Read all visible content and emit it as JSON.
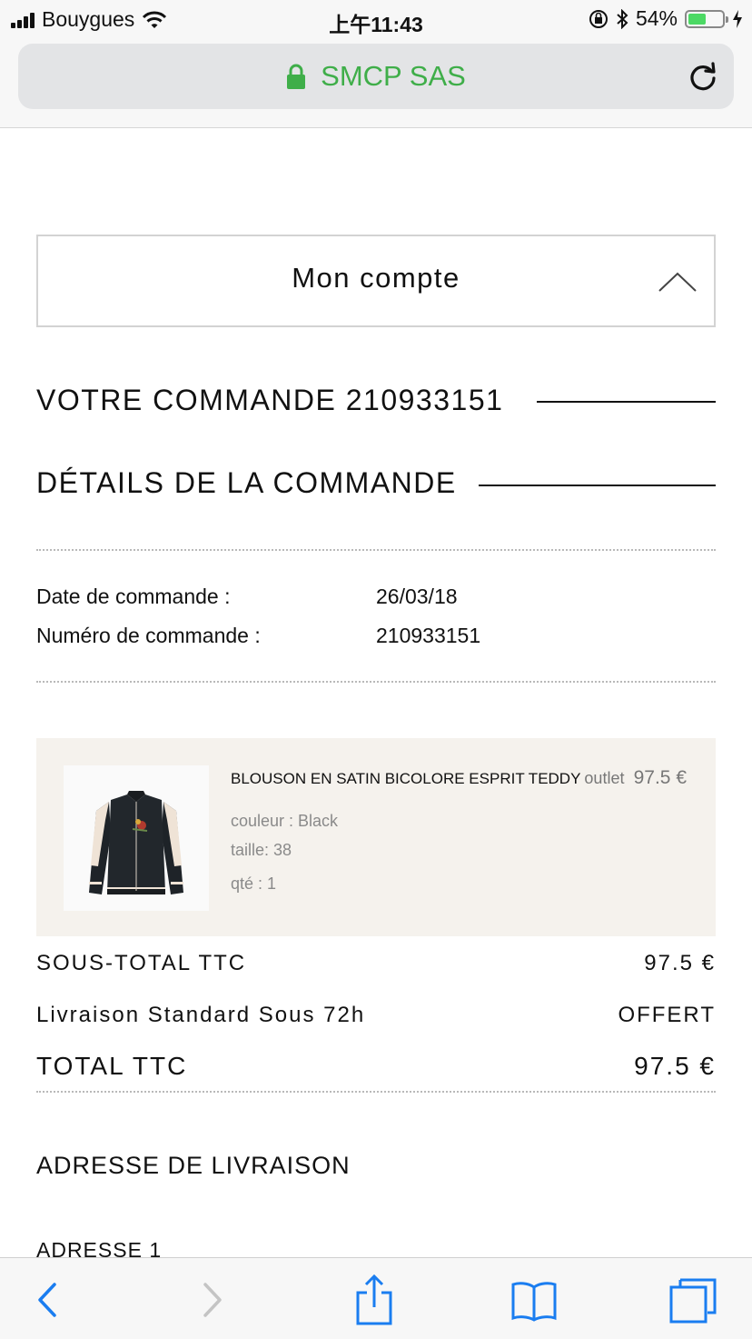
{
  "status_bar": {
    "carrier": "Bouygues",
    "time": "上午11:43",
    "battery_percent": "54%",
    "battery_level": 0.54,
    "icons": [
      "signal-icon",
      "wifi-icon",
      "orientation-lock-icon",
      "bluetooth-icon",
      "battery-icon",
      "charging-icon"
    ]
  },
  "browser": {
    "site_label": "SMCP SAS",
    "secure": true,
    "accent_color": "#3fae49",
    "toolbar_icons": [
      "back-icon",
      "forward-icon",
      "share-icon",
      "bookmarks-icon",
      "tabs-icon"
    ]
  },
  "account": {
    "title": "Mon compte",
    "expanded": true
  },
  "order": {
    "heading": "VOTRE COMMANDE 210933151",
    "details_heading": "DÉTAILS DE LA COMMANDE",
    "date_label": "Date de commande :",
    "date_value": "26/03/18",
    "number_label": "Numéro de commande :",
    "number_value": "210933151"
  },
  "product": {
    "name": "BLOUSON EN SATIN BICOLORE ESPRIT TEDDY",
    "tag": "outlet",
    "price": "97.5 €",
    "color": "couleur : Black",
    "size": "taille: 38",
    "quantity": "qté : 1",
    "background": "#f5f2ed"
  },
  "totals": {
    "subtotal_label": "SOUS-TOTAL TTC",
    "subtotal_value": "97.5 €",
    "shipping_label": "Livraison Standard Sous 72h",
    "shipping_value": "OFFERT",
    "total_label": "TOTAL TTC",
    "total_value": "97.5 €"
  },
  "address": {
    "heading": "ADRESSE DE LIVRAISON",
    "line1_label": "ADRESSE 1"
  }
}
